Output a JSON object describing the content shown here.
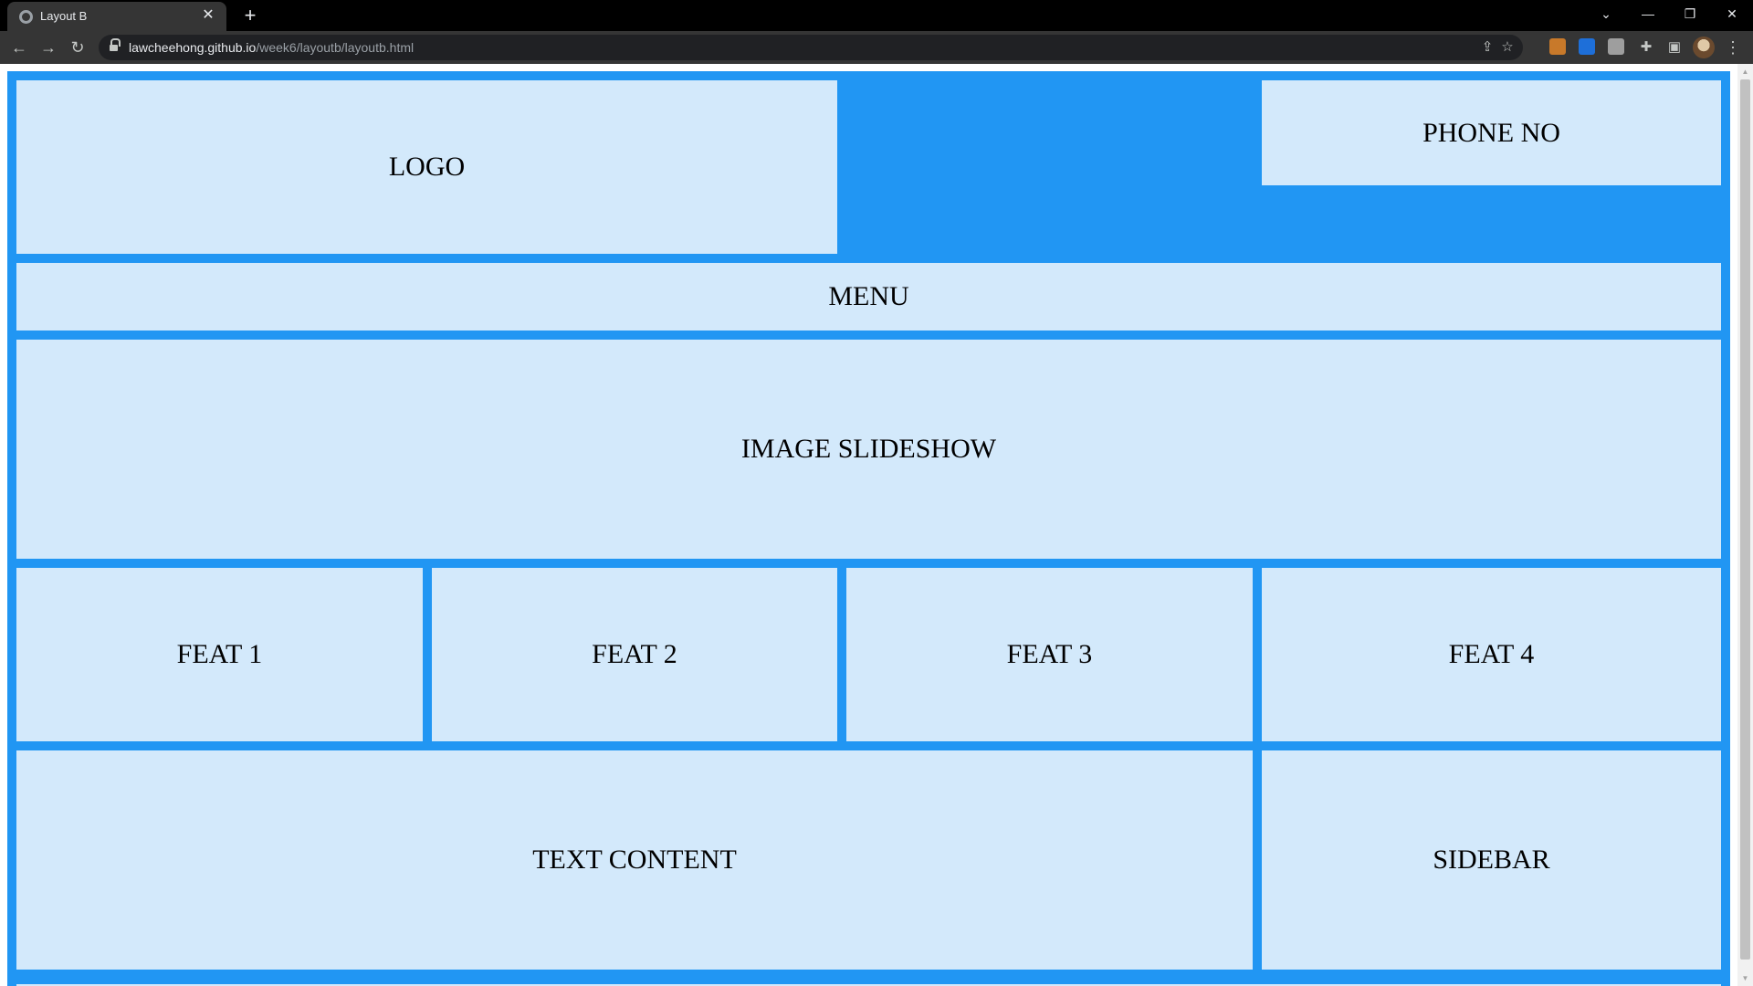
{
  "browser": {
    "tab_title": "Layout B",
    "tab_close": "✕",
    "new_tab": "+",
    "url_host": "lawcheehong.github.io",
    "url_path": "/week6/layoutb/layoutb.html",
    "icons": [
      "back-arrow-icon",
      "forward-arrow-icon",
      "reload-icon",
      "lock-icon",
      "share-icon",
      "star-icon",
      "extensions-icon",
      "side-panel-icon",
      "profile-avatar",
      "kebab-menu-icon"
    ],
    "colors": {
      "chrome_bg": "#000000",
      "toolbar_bg": "#353535",
      "omnibox_bg": "#202124"
    }
  },
  "page": {
    "colors": {
      "frame": "#2196f3",
      "box": "#d3e9fb",
      "text": "#000000"
    },
    "header": {
      "logo": "LOGO",
      "phone": "PHONE NO"
    },
    "menu": "MENU",
    "slideshow": "IMAGE SLIDESHOW",
    "features": [
      "FEAT 1",
      "FEAT 2",
      "FEAT 3",
      "FEAT 4"
    ],
    "content": {
      "text": "TEXT CONTENT",
      "sidebar": "SIDEBAR"
    }
  }
}
